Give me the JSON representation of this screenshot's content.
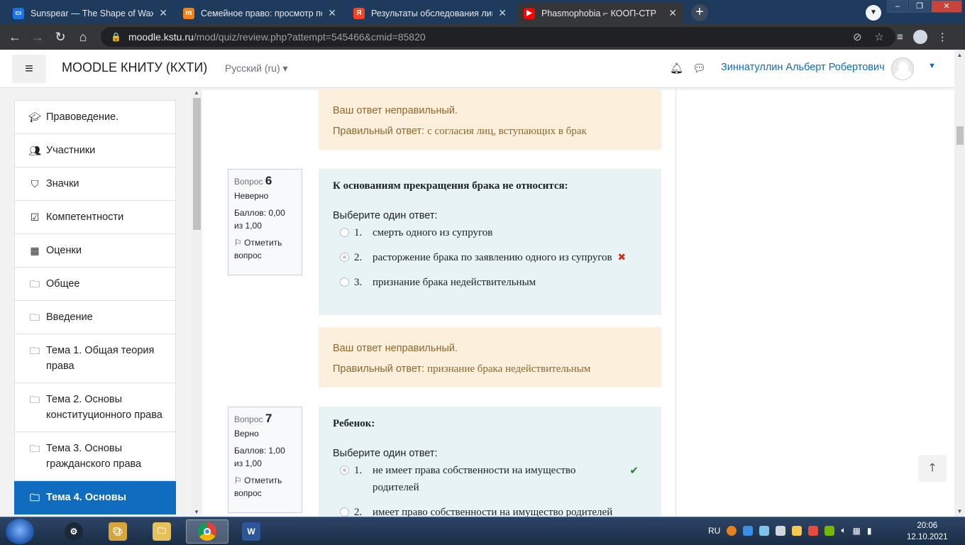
{
  "browser": {
    "tabs": [
      {
        "title": "Sunspear — The Shape of Wax",
        "icon": "chat-icon",
        "color": "#1a73e8"
      },
      {
        "title": "Семейное право: просмотр поп",
        "icon": "moodle-icon",
        "color": "#f98012"
      },
      {
        "title": "Результаты обследования лица,",
        "icon": "yandex-icon",
        "color": "#fc3f1d"
      },
      {
        "title": "Phasmophobia ⌐ КООП-СТР",
        "icon": "youtube-icon",
        "color": "#ff0000"
      }
    ],
    "url_host": "moodle.kstu.ru",
    "url_path": "/mod/quiz/review.php?attempt=545466&cmid=85820"
  },
  "navbar": {
    "site_name": "MOODLE КНИТУ (КХТИ)",
    "language": "Русский (ru)",
    "user_name": "Зиннатуллин Альберт Робертович"
  },
  "drawer": {
    "items": [
      {
        "label": "Правоведение.",
        "icon": "graduation-cap-icon"
      },
      {
        "label": "Участники",
        "icon": "users-icon"
      },
      {
        "label": "Значки",
        "icon": "shield-icon"
      },
      {
        "label": "Компетентности",
        "icon": "checkbox-icon"
      },
      {
        "label": "Оценки",
        "icon": "table-icon"
      },
      {
        "label": "Общее",
        "icon": "folder-icon"
      },
      {
        "label": "Введение",
        "icon": "folder-icon"
      },
      {
        "label": "Тема 1. Общая теория права",
        "icon": "folder-icon"
      },
      {
        "label": "Тема 2. Основы конституционного права",
        "icon": "folder-icon"
      },
      {
        "label": "Тема 3. Основы гражданского права",
        "icon": "folder-icon"
      },
      {
        "label": "Тема 4. Основы",
        "icon": "folder-icon"
      }
    ]
  },
  "feedback_prev": {
    "status": "Ваш ответ неправильный.",
    "correct_label": "Правильный ответ:",
    "correct_value": "с согласия лиц, вступающих в брак"
  },
  "q6": {
    "label": "Вопрос",
    "number": "6",
    "state": "Неверно",
    "grade": "Баллов: 0,00 из 1,00",
    "flag": "Отметить вопрос",
    "text": "К основаниям прекращения брака не относится:",
    "prompt": "Выберите один ответ:",
    "answers": [
      {
        "num": "1.",
        "text": "смерть одного из супругов"
      },
      {
        "num": "2.",
        "text": "расторжение брака по заявлению одного из супругов"
      },
      {
        "num": "3.",
        "text": "признание брака недействительным"
      }
    ],
    "feedback_status": "Ваш ответ неправильный.",
    "feedback_correct_label": "Правильный ответ:",
    "feedback_correct_value": "признание брака недействительным"
  },
  "q7": {
    "label": "Вопрос",
    "number": "7",
    "state": "Верно",
    "grade": "Баллов: 1,00 из 1,00",
    "flag": "Отметить вопрос",
    "text": "Ребенок:",
    "prompt": "Выберите один ответ:",
    "answers": [
      {
        "num": "1.",
        "text": "не имеет права собственности на имущество родителей"
      },
      {
        "num": "2.",
        "text": "имеет право собственности на имущество родителей"
      }
    ]
  },
  "taskbar": {
    "language": "RU",
    "time": "20:06",
    "date": "12.10.2021"
  }
}
